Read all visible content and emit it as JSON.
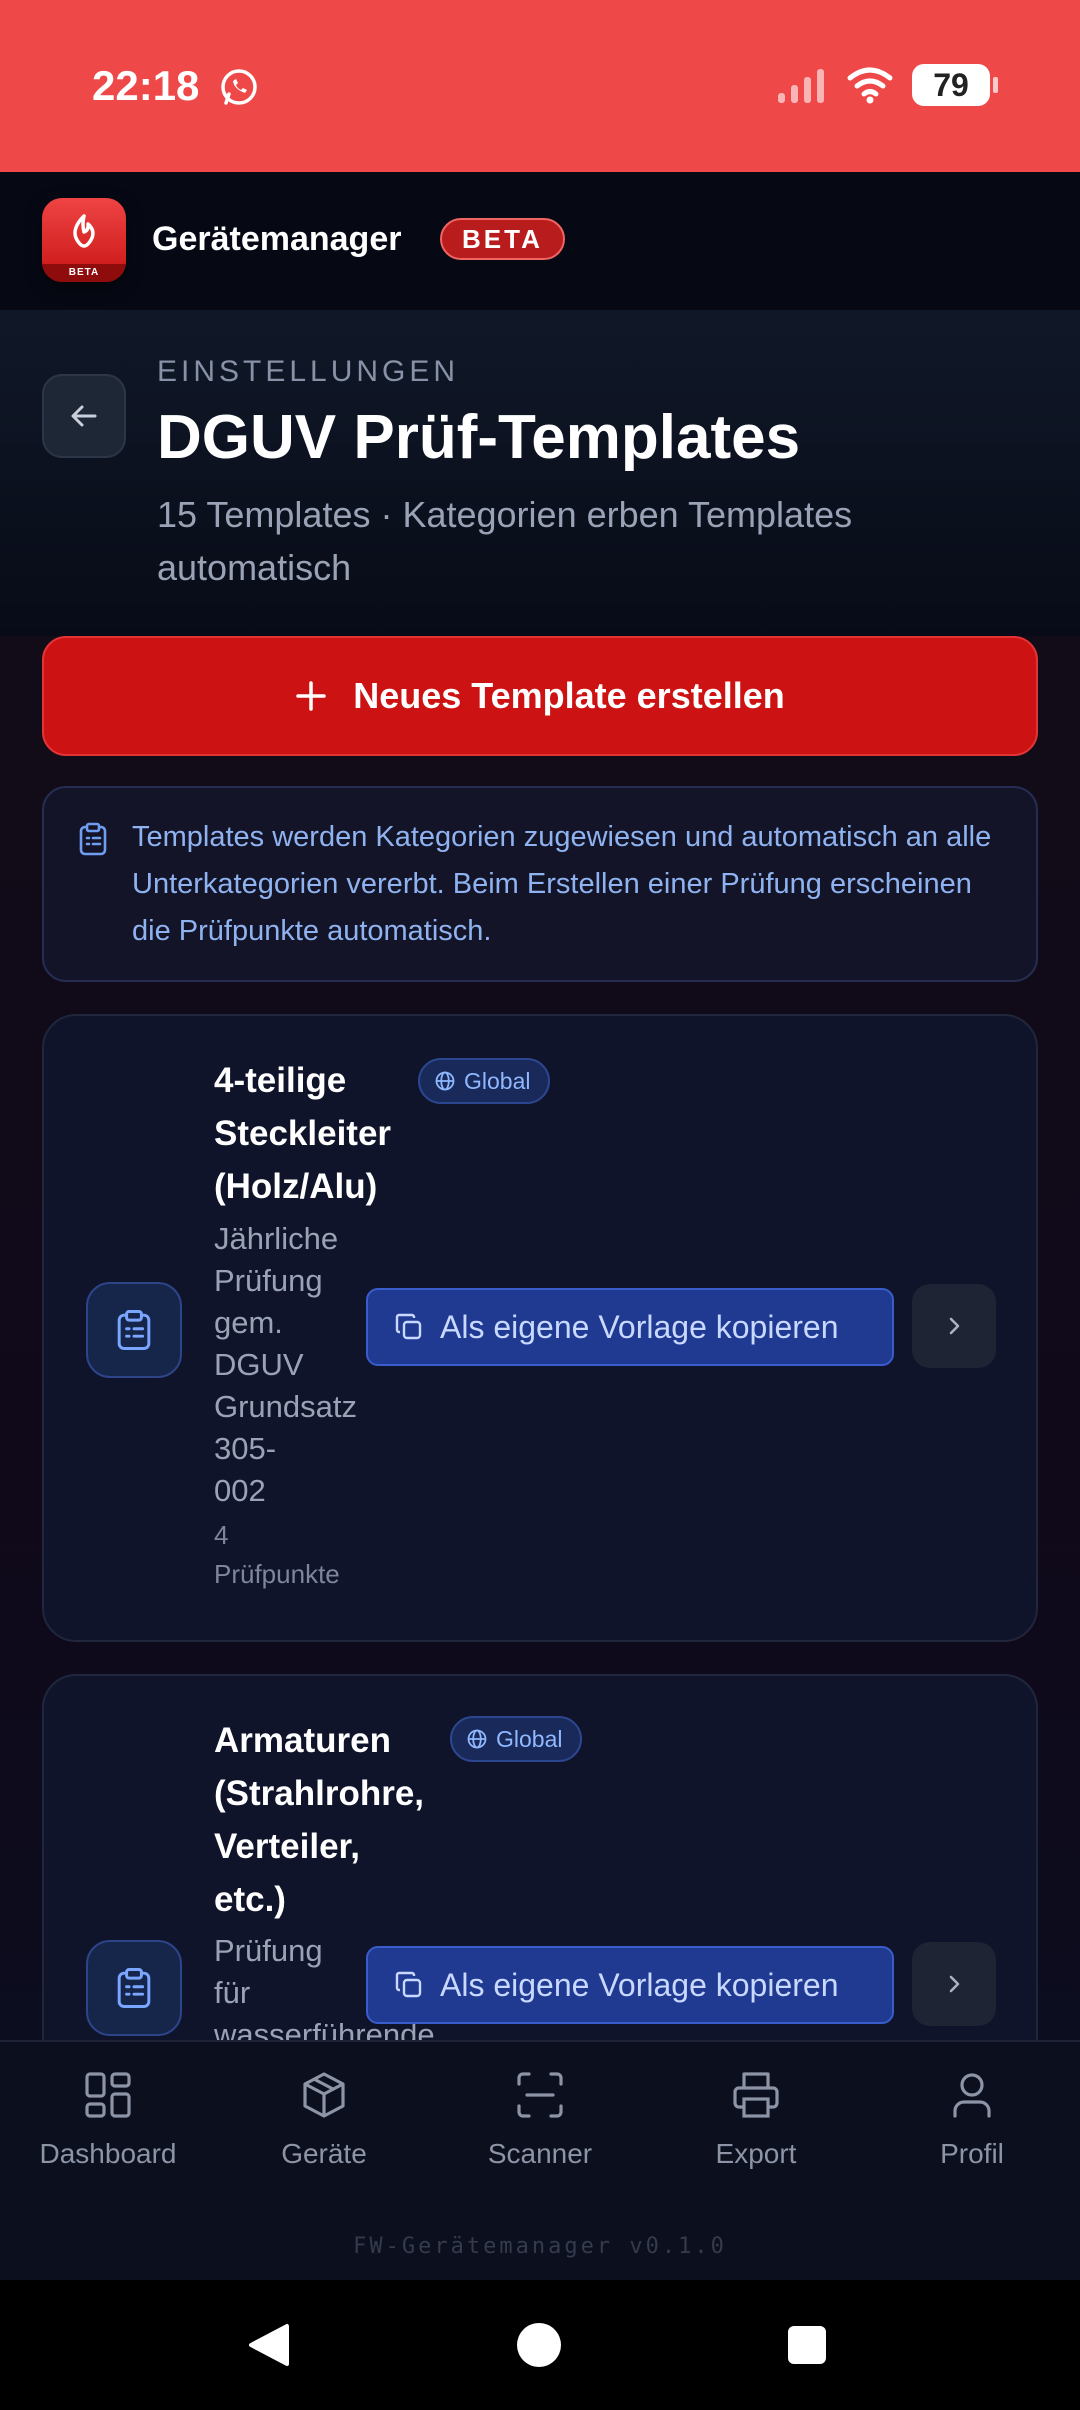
{
  "status_bar": {
    "time": "22:18",
    "battery": "79",
    "bg_color": "#ef4848"
  },
  "app": {
    "name": "Gerätemanager",
    "beta_badge": "BETA",
    "logo_badge": "BETA"
  },
  "page": {
    "breadcrumb": "EINSTELLUNGEN",
    "title": "DGUV Prüf-Templates",
    "subtitle": "15 Templates · Kategorien erben Templates automatisch"
  },
  "actions": {
    "new_template": "Neues Template erstellen"
  },
  "info": {
    "text": "Templates werden Kategorien zugewiesen und automatisch an alle Unterkategorien vererbt. Beim Erstellen einer Prüfung erscheinen die Prüfpunkte automatisch."
  },
  "templates": [
    {
      "title_lines": [
        "4-teilige",
        "Steckleiter",
        "(Holz/Alu)"
      ],
      "scope": "Global",
      "desc_lines": [
        "Jährliche",
        "Prüfung",
        "gem.",
        "DGUV",
        "Grundsatz",
        "305-",
        "002"
      ],
      "count_lines": [
        "4",
        "Prüfpunkte"
      ],
      "copy_label": "Als eigene Vorlage kopieren"
    },
    {
      "title_lines": [
        "Armaturen",
        "(Strahlrohre,",
        "Verteiler,",
        "etc.)"
      ],
      "scope": "Global",
      "desc_lines": [
        "Prüfung",
        "für",
        "wasserführende"
      ],
      "copy_label": "Als eigene Vorlage kopieren"
    }
  ],
  "nav": {
    "items": [
      {
        "label": "Dashboard",
        "icon": "dashboard-icon"
      },
      {
        "label": "Geräte",
        "icon": "box-icon"
      },
      {
        "label": "Scanner",
        "icon": "scan-icon"
      },
      {
        "label": "Export",
        "icon": "printer-icon"
      },
      {
        "label": "Profil",
        "icon": "user-icon"
      }
    ],
    "version": "FW-Gerätemanager v0.1.0"
  },
  "colors": {
    "accent_red": "#cc1212",
    "accent_blue": "#203a92",
    "badge_blue": "#8fb8ff"
  }
}
